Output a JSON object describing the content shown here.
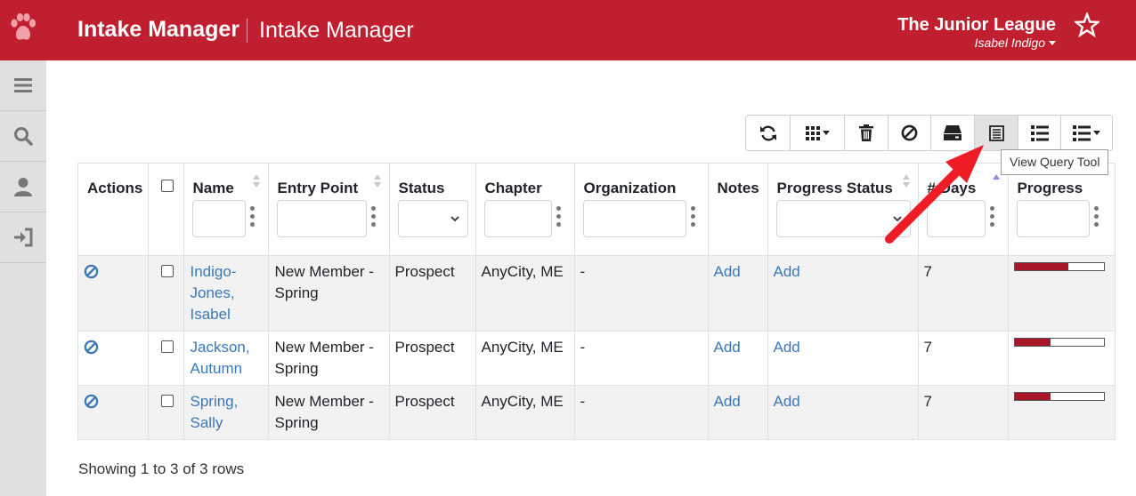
{
  "colors": {
    "brand": "#c01f2f",
    "link": "#3a78b8",
    "progress": "#a8162a",
    "annotation": "#ee1c24"
  },
  "header": {
    "app_title": "Intake Manager",
    "app_subtitle": "Intake Manager",
    "org_name": "The Junior League",
    "user_name": "Isabel Indigo",
    "logo_icon": "paw-icon",
    "favorite_icon": "star-icon"
  },
  "sidebar": {
    "items": [
      {
        "name": "menu",
        "icon": "hamburger-icon"
      },
      {
        "name": "search",
        "icon": "search-icon"
      },
      {
        "name": "profile",
        "icon": "user-icon"
      },
      {
        "name": "logout",
        "icon": "sign-out-icon"
      }
    ]
  },
  "toolbar": {
    "buttons": [
      {
        "name": "refresh",
        "icon": "refresh-icon"
      },
      {
        "name": "columns",
        "icon": "grid-icon",
        "dropdown": true
      },
      {
        "name": "delete",
        "icon": "trash-icon"
      },
      {
        "name": "disable",
        "icon": "ban-icon"
      },
      {
        "name": "archive",
        "icon": "inbox-icon"
      },
      {
        "name": "query",
        "icon": "query-icon",
        "active": true
      },
      {
        "name": "list",
        "icon": "list-icon"
      },
      {
        "name": "list-options",
        "icon": "list-icon",
        "dropdown": true
      }
    ],
    "tooltip": "View Query Tool"
  },
  "table": {
    "columns": [
      "Actions",
      "",
      "Name",
      "Entry Point",
      "Status",
      "Chapter",
      "Organization",
      "Notes",
      "Progress Status",
      "# Days",
      "Progress"
    ],
    "rows": [
      {
        "name": "Indigo-Jones, Isabel",
        "entry_point": "New Member - Spring",
        "status": "Prospect",
        "chapter": "AnyCity, ME",
        "organization": "-",
        "notes": "Add",
        "progress_status": "Add",
        "days": "7",
        "progress": 0.6
      },
      {
        "name": "Jackson, Autumn",
        "entry_point": "New Member - Spring",
        "status": "Prospect",
        "chapter": "AnyCity, ME",
        "organization": "-",
        "notes": "Add",
        "progress_status": "Add",
        "days": "7",
        "progress": 0.4
      },
      {
        "name": "Spring, Sally",
        "entry_point": "New Member - Spring",
        "status": "Prospect",
        "chapter": "AnyCity, ME",
        "organization": "-",
        "notes": "Add",
        "progress_status": "Add",
        "days": "7",
        "progress": 0.4
      }
    ]
  },
  "footer": {
    "summary": "Showing 1 to 3 of 3 rows"
  }
}
